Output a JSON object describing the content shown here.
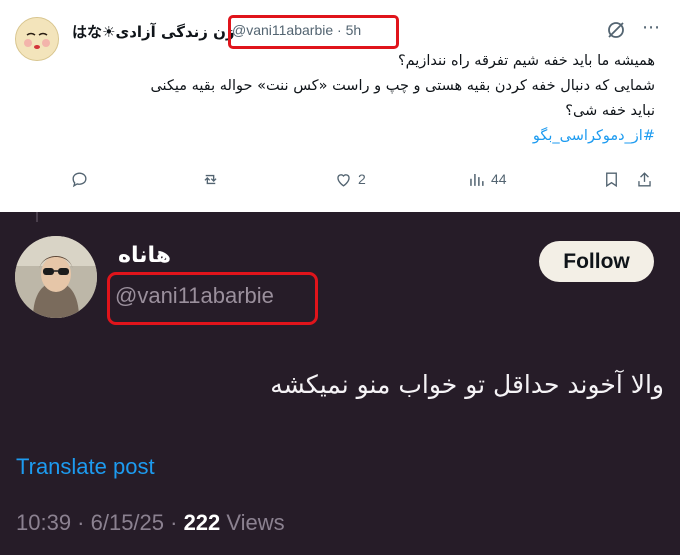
{
  "quoted_tweet": {
    "display_name": "زن زندگی آزادی☀︎はな",
    "handle": "@vani11abarbie",
    "time": "· 5h",
    "lines": [
      "همیشه ما باید خفه شیم تفرقه راه نندازیم؟",
      "شمایی که دنبال خفه کردن بقیه هستی و چپ و راست «کس ننت» حواله بقیه میکنی",
      "نباید خفه شی؟"
    ],
    "hashtag": "#از_دموکراسی_بگو",
    "actions": {
      "reply_count": "",
      "retweet_count": "",
      "like_count": "2",
      "views_count": "44"
    }
  },
  "main_tweet": {
    "display_name": "هاناه",
    "handle": "@vani11abarbie",
    "follow_label": "Follow",
    "text": "والا آخوند حداقل تو خواب منو نمیکشه",
    "translate_label": "Translate post",
    "timestamp": "10:39 · 6/15/25 · ",
    "views_count": "222",
    "views_label": " Views"
  },
  "colors": {
    "highlight_box": "#e0141b",
    "link": "#1d9bf0",
    "dark_bg": "#261c28"
  }
}
